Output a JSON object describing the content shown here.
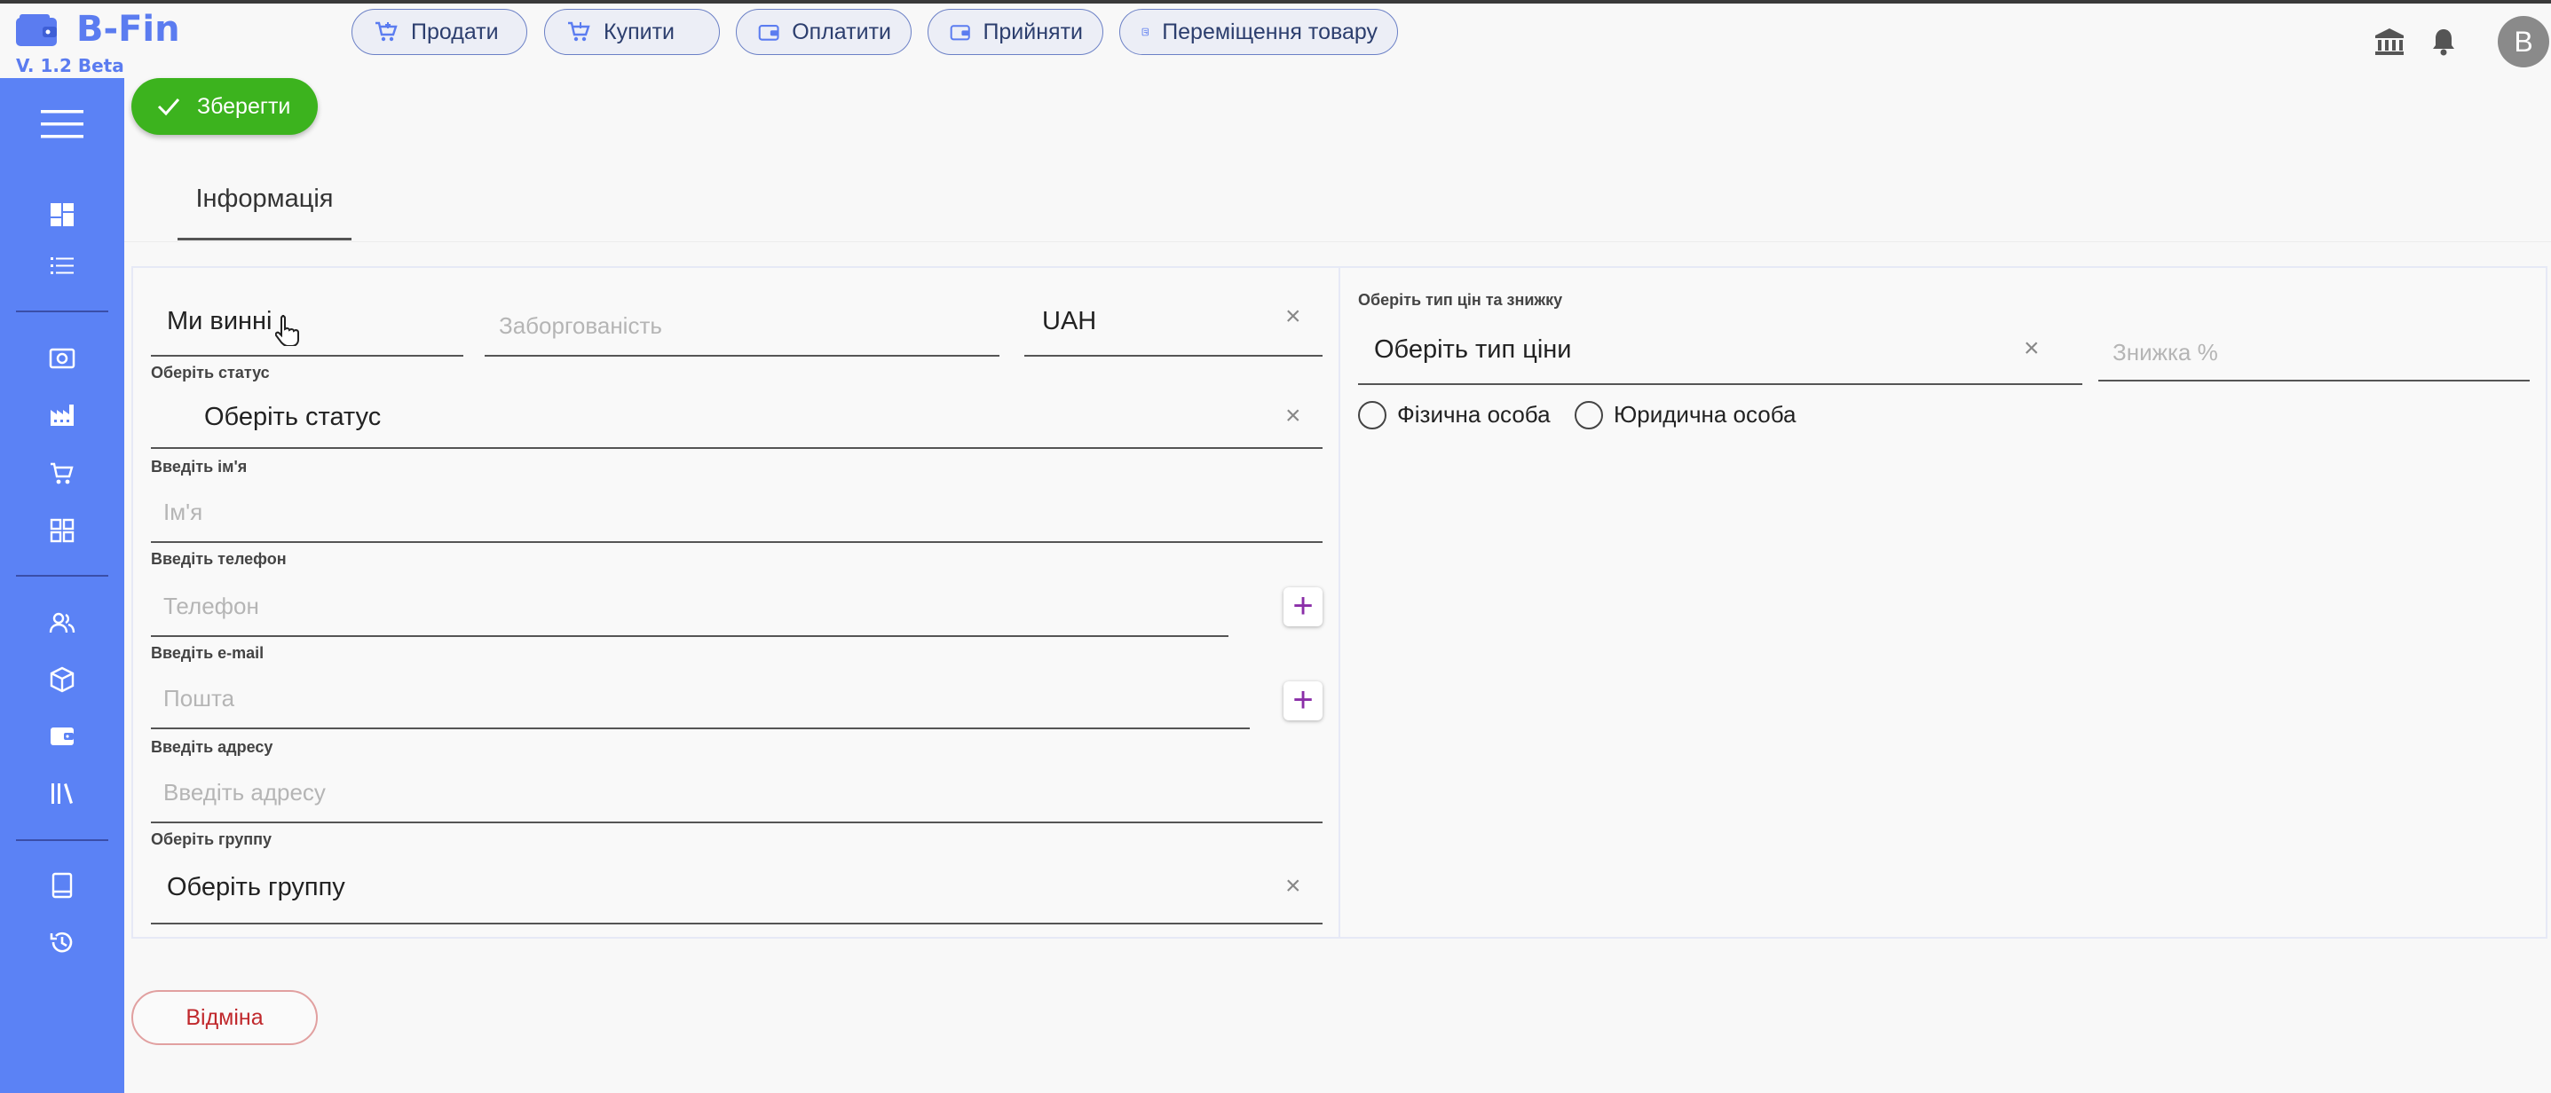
{
  "app": {
    "name": "B-Fin",
    "version": "V. 1.2 Beta",
    "brand_color": "#5b7cf0",
    "sidebar_color": "#5b82f5"
  },
  "topnav": {
    "buttons": [
      {
        "label": "Продати",
        "icon": "cart-sell-icon"
      },
      {
        "label": "Купити",
        "icon": "cart-buy-icon"
      },
      {
        "label": "Оплатити",
        "icon": "wallet-icon"
      },
      {
        "label": "Прийняти",
        "icon": "wallet-receive-icon"
      },
      {
        "label": "Переміщення товару",
        "icon": "transfer-icon"
      }
    ],
    "avatar_letter": "B",
    "right_icons": [
      "bank-icon",
      "bell-icon"
    ]
  },
  "sidebar": {
    "icons": [
      "menu-icon",
      "dashboard-icon",
      "list-icon",
      "money-icon",
      "factory-icon",
      "cart-icon",
      "apps-icon",
      "users-icon",
      "box-icon",
      "wallet-icon",
      "library-icon",
      "book-icon",
      "history-icon"
    ]
  },
  "toolbar": {
    "save_label": "Зберегти",
    "cancel_label": "Відміна",
    "save_color": "#3cb31e",
    "cancel_color": "#c0282c"
  },
  "tabs": [
    {
      "label": "Інформація",
      "active": true
    }
  ],
  "form": {
    "debt_type_value": "Ми винні",
    "debt_placeholder": "Заборгованість",
    "currency_value": "UAH",
    "status_label": "Оберіть статус",
    "status_value": "Оберіть статус",
    "name_label": "Введіть ім'я",
    "name_placeholder": "Ім'я",
    "phone_label": "Введіть телефон",
    "phone_placeholder": "Телефон",
    "email_label": "Введіть e-mail",
    "email_placeholder": "Пошта",
    "address_label": "Введіть адресу",
    "address_placeholder": "Введіть адресу",
    "group_label": "Оберіть группу",
    "group_value": "Оберіть группу"
  },
  "pricing": {
    "label": "Оберіть тип цін та знижку",
    "price_type_value": "Оберіть тип ціни",
    "discount_placeholder": "Знижка %",
    "person_types": [
      {
        "label": "Фізична особа",
        "selected": false
      },
      {
        "label": "Юридична особа",
        "selected": false
      }
    ]
  }
}
